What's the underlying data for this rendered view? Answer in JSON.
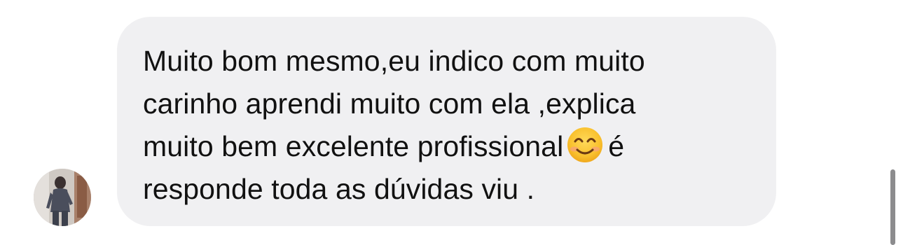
{
  "message": {
    "lines": [
      "Muito bom mesmo,eu indico com muito",
      "carinho aprendi muito com ela ,explica",
      "muito bem excelente profissional",
      "é",
      "responde toda as dúvidas viu ."
    ],
    "emoji": "smiling-face-with-smiling-eyes"
  },
  "colors": {
    "bubble": "#f0f0f2",
    "text": "#111111",
    "scrollbar": "#8c8c8e"
  }
}
